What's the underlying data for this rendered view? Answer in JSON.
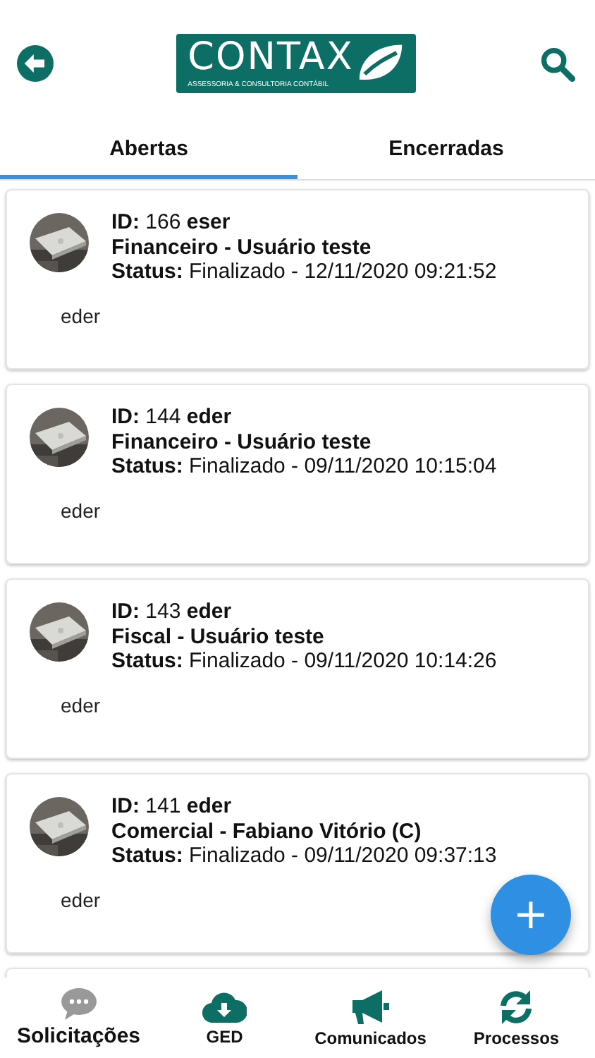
{
  "header": {
    "logo_title": "CONTAX",
    "logo_subtitle": "ASSESSORIA & CONSULTORIA CONTÁBIL"
  },
  "tabs": [
    {
      "label": "Abertas",
      "selected": true
    },
    {
      "label": "Encerradas",
      "selected": false
    }
  ],
  "tickets": [
    {
      "id_line": "**ID:** 166 **eser**",
      "subject": "Financeiro - Usuário teste",
      "status": "**Status:** Finalizado - 12/11/2020 09:21:52",
      "body": "eder"
    },
    {
      "id_line": "**ID:** 144 **eder**",
      "subject": "Financeiro - Usuário teste",
      "status": "**Status:** Finalizado - 09/11/2020 10:15:04",
      "body": "eder"
    },
    {
      "id_line": "**ID:** 143 **eder**",
      "subject": "Fiscal - Usuário teste",
      "status": "**Status:** Finalizado - 09/11/2020 10:14:26",
      "body": "eder"
    },
    {
      "id_line": "**ID:** 141 **eder**",
      "subject": "Comercial - Fabiano Vitório (C)",
      "status": "**Status:** Finalizado - 09/11/2020 09:37:13",
      "body": "eder"
    }
  ],
  "fab": {
    "label": "+"
  },
  "bottom_nav": [
    {
      "kind": "chat",
      "label": "Solicitações",
      "selected": true
    },
    {
      "kind": "cloud",
      "label": "GED",
      "selected": false
    },
    {
      "kind": "megaphone",
      "label": "Comunicados",
      "selected": false
    },
    {
      "kind": "sync",
      "label": "Processos",
      "selected": false
    }
  ]
}
